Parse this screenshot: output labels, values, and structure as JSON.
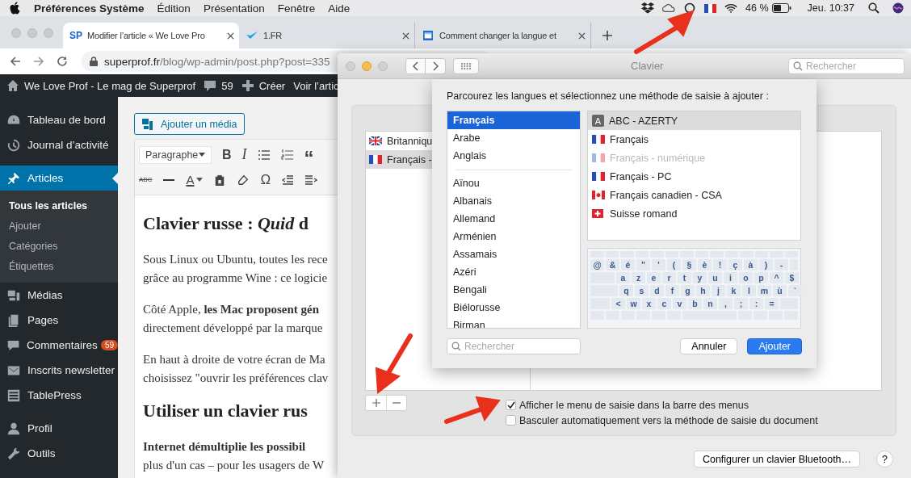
{
  "menubar": {
    "app": "Préférences Système",
    "menus": [
      "Édition",
      "Présentation",
      "Fenêtre",
      "Aide"
    ],
    "battery": "46 %",
    "clock": "Jeu. 10:37"
  },
  "browser": {
    "tabs": [
      {
        "title": "Modifier l’article « We Love Pro",
        "selected": true,
        "kind": "sp",
        "icon_text": "SP"
      },
      {
        "title": "1.FR",
        "selected": false,
        "kind": "check"
      },
      {
        "title": "Comment changer la langue et",
        "selected": false,
        "kind": "windows"
      }
    ],
    "address": {
      "host": "superprof.fr",
      "path": "/blog/wp-admin/post.php?post=335"
    }
  },
  "admin_bar": {
    "site": "We Love Prof - Le mag de Superprof",
    "comments": "59",
    "new": "Créer",
    "view": "Voir l’artic"
  },
  "sidebar": {
    "groups": [
      {
        "items": [
          {
            "label": "Tableau de bord",
            "kind": "dashboard",
            "selected": false
          },
          {
            "label": "Journal d’activité",
            "kind": "history",
            "selected": false
          }
        ]
      },
      {
        "items": [
          {
            "label": "Articles",
            "kind": "pin",
            "selected": true,
            "children": [
              {
                "label": "Tous les articles",
                "selected": true
              },
              {
                "label": "Ajouter",
                "selected": false
              },
              {
                "label": "Catégories",
                "selected": false
              },
              {
                "label": "Étiquettes",
                "selected": false
              }
            ]
          },
          {
            "label": "Médias",
            "kind": "media",
            "selected": false
          },
          {
            "label": "Pages",
            "kind": "pages",
            "selected": false
          },
          {
            "label": "Commentaires",
            "kind": "comments",
            "selected": false,
            "badge": "59"
          },
          {
            "label": "Inscrits newsletter",
            "kind": "mail",
            "selected": false
          },
          {
            "label": "TablePress",
            "kind": "table",
            "selected": false
          }
        ]
      },
      {
        "items": [
          {
            "label": "Profil",
            "kind": "user",
            "selected": false
          },
          {
            "label": "Outils",
            "kind": "wrench",
            "selected": false
          }
        ]
      }
    ]
  },
  "editor": {
    "add_media": "Ajouter un média",
    "format": "Paragraphe",
    "toolbar": [
      [
        {
          "kind": "bold",
          "glyph": "B"
        },
        {
          "kind": "italic",
          "glyph": "I"
        },
        {
          "kind": "bullets"
        },
        {
          "kind": "numbers"
        },
        {
          "kind": "quote",
          "glyph": "“"
        }
      ],
      [
        {
          "kind": "strike",
          "glyph": "ABC"
        },
        {
          "kind": "rule"
        },
        {
          "kind": "color",
          "glyph": "A"
        },
        {
          "kind": "paste"
        },
        {
          "kind": "eraser"
        },
        {
          "kind": "omega",
          "glyph": "Ω"
        },
        {
          "kind": "outdent"
        },
        {
          "kind": "indent"
        }
      ]
    ],
    "blocks": [
      {
        "kind": "heading",
        "text": "Clavier russe : *Quid* d"
      },
      {
        "kind": "paragraph",
        "lines": [
          "Sous Linux ou Ubuntu, toutes les rece",
          "grâce au programme Wine : ce logicie"
        ]
      },
      {
        "kind": "paragraph",
        "lines": [
          "Côté Apple, **les Mac proposent gén**",
          "directement développé par la marque"
        ]
      },
      {
        "kind": "paragraph",
        "lines": [
          "En haut à droite de votre écran de Ma",
          "choisissez \"ouvrir les préférences clav"
        ]
      },
      {
        "kind": "heading",
        "text": "Utiliser un clavier rus"
      },
      {
        "kind": "paragraph",
        "lines": [
          "**Internet démultiplie les possibil**",
          "plus d'un cas – pour les usagers de W"
        ]
      }
    ]
  },
  "clavier": {
    "title": "Clavier",
    "search_placeholder": "Rechercher",
    "sources": [
      {
        "name": "Britanniqu",
        "kind": "uk",
        "selected": false
      },
      {
        "name": "Français -",
        "kind": "france",
        "selected": true
      }
    ],
    "options": [
      {
        "label": "Afficher le menu de saisie dans la barre des menus",
        "checked": true
      },
      {
        "label": "Basculer automatiquement vers la méthode de saisie du document",
        "checked": false
      }
    ],
    "bluetooth_button": "Configurer un clavier Bluetooth…",
    "help": "?"
  },
  "sheet": {
    "prompt": "Parcourez les langues et sélectionnez une méthode de saisie à ajouter :",
    "preferred_languages": [
      {
        "name": "Français",
        "selected": true
      },
      {
        "name": "Arabe",
        "selected": false
      },
      {
        "name": "Anglais",
        "selected": false
      }
    ],
    "languages": [
      {
        "name": "Aïnou",
        "selected": false
      },
      {
        "name": "Albanais",
        "selected": false
      },
      {
        "name": "Allemand",
        "selected": false
      },
      {
        "name": "Arménien",
        "selected": false
      },
      {
        "name": "Assamais",
        "selected": false
      },
      {
        "name": "Azéri",
        "selected": false
      },
      {
        "name": "Bengali",
        "selected": false
      },
      {
        "name": "Biélorusse",
        "selected": false
      },
      {
        "name": "Birman",
        "selected": false
      }
    ],
    "methods": [
      {
        "name": "ABC - AZERTY",
        "kind": "abc",
        "icon_text": "A",
        "selected": true,
        "disabled": false
      },
      {
        "name": "Français",
        "kind": "france",
        "selected": false,
        "disabled": false
      },
      {
        "name": "Français - numérique",
        "kind": "france",
        "selected": false,
        "disabled": true
      },
      {
        "name": "Français - PC",
        "kind": "france",
        "selected": false,
        "disabled": false
      },
      {
        "name": "Français canadien - CSA",
        "kind": "canada",
        "selected": false,
        "disabled": false
      },
      {
        "name": "Suisse romand",
        "kind": "swiss",
        "selected": false,
        "disabled": false
      }
    ],
    "keyboard": [
      [
        "@",
        "&",
        "é",
        "\"",
        "'",
        "(",
        "§",
        "è",
        "!",
        "ç",
        "à",
        ")",
        "-"
      ],
      [
        "a",
        "z",
        "e",
        "r",
        "t",
        "y",
        "u",
        "i",
        "o",
        "p",
        "^",
        "$"
      ],
      [
        "q",
        "s",
        "d",
        "f",
        "g",
        "h",
        "j",
        "k",
        "l",
        "m",
        "ù",
        "`"
      ],
      [
        "<",
        "w",
        "x",
        "c",
        "v",
        "b",
        "n",
        ",",
        ";",
        ":",
        "="
      ]
    ],
    "search_placeholder": "Rechercher",
    "cancel": "Annuler",
    "add": "Ajouter"
  }
}
